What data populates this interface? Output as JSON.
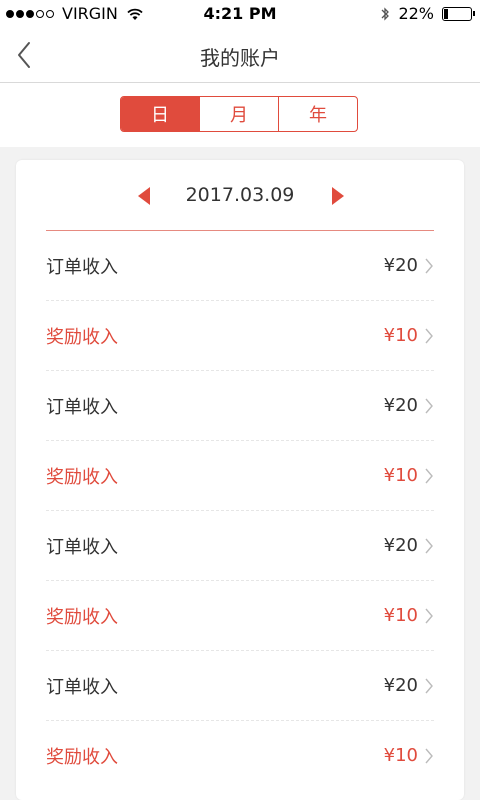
{
  "status_bar": {
    "carrier": "VIRGIN",
    "time": "4:21 PM",
    "battery": "22%",
    "battery_level": 0.22
  },
  "nav": {
    "title": "我的账户"
  },
  "tabs": [
    {
      "label": "日",
      "active": true
    },
    {
      "label": "月",
      "active": false
    },
    {
      "label": "年",
      "active": false
    }
  ],
  "date": "2017.03.09",
  "accent_color": "#e04b3d",
  "rows": [
    {
      "label": "订单收入",
      "amount": "¥20",
      "type": "income"
    },
    {
      "label": "奖励收入",
      "amount": "¥10",
      "type": "bonus"
    },
    {
      "label": "订单收入",
      "amount": "¥20",
      "type": "income"
    },
    {
      "label": "奖励收入",
      "amount": "¥10",
      "type": "bonus"
    },
    {
      "label": "订单收入",
      "amount": "¥20",
      "type": "income"
    },
    {
      "label": "奖励收入",
      "amount": "¥10",
      "type": "bonus"
    },
    {
      "label": "订单收入",
      "amount": "¥20",
      "type": "income"
    },
    {
      "label": "奖励收入",
      "amount": "¥10",
      "type": "bonus"
    }
  ]
}
